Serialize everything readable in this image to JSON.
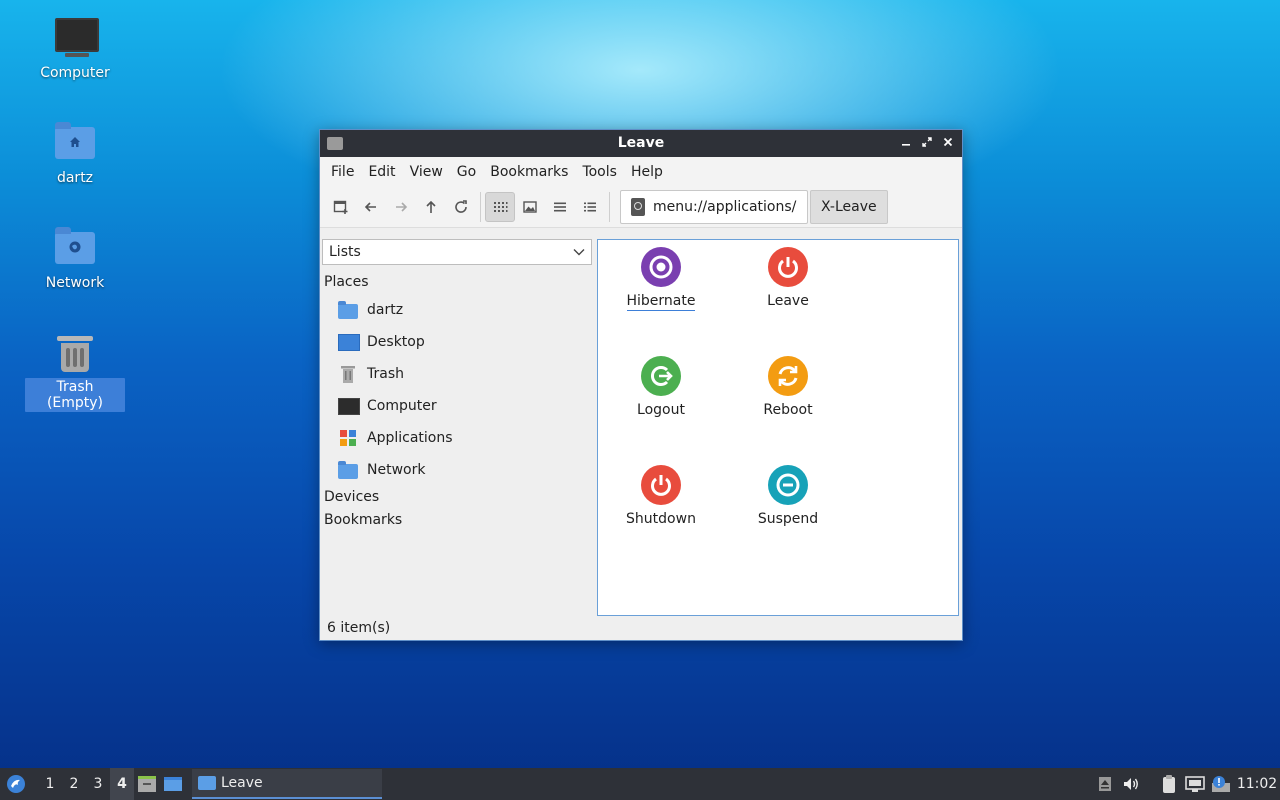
{
  "desktop": {
    "icons": [
      {
        "label": "Computer",
        "icon": "computer-icon"
      },
      {
        "label": "dartz",
        "icon": "home-folder-icon"
      },
      {
        "label": "Network",
        "icon": "network-folder-icon"
      },
      {
        "label": "Trash (Empty)",
        "icon": "trash-icon"
      }
    ]
  },
  "window": {
    "title": "Leave",
    "menu": [
      "File",
      "Edit",
      "View",
      "Go",
      "Bookmarks",
      "Tools",
      "Help"
    ],
    "path": "menu://applications/",
    "breadcrumb": "X-Leave",
    "sidebar": {
      "selector": "Lists",
      "sections": {
        "places": "Places",
        "devices": "Devices",
        "bookmarks": "Bookmarks"
      },
      "places": [
        {
          "label": "dartz",
          "icon": "home-folder-icon"
        },
        {
          "label": "Desktop",
          "icon": "desktop-icon"
        },
        {
          "label": "Trash",
          "icon": "trash-icon"
        },
        {
          "label": "Computer",
          "icon": "computer-icon"
        },
        {
          "label": "Applications",
          "icon": "applications-icon"
        },
        {
          "label": "Network",
          "icon": "network-folder-icon"
        }
      ]
    },
    "items": [
      {
        "label": "Hibernate",
        "icon": "hibernate-icon",
        "color": "#7a3fb0"
      },
      {
        "label": "Leave",
        "icon": "power-icon",
        "color": "#e84c3d"
      },
      {
        "label": "Logout",
        "icon": "logout-icon",
        "color": "#4caf50"
      },
      {
        "label": "Reboot",
        "icon": "reboot-icon",
        "color": "#f39c12"
      },
      {
        "label": "Shutdown",
        "icon": "shutdown-icon",
        "color": "#e84c3d"
      },
      {
        "label": "Suspend",
        "icon": "suspend-icon",
        "color": "#17a2b8"
      }
    ],
    "status": "6 item(s)"
  },
  "taskbar": {
    "workspaces": [
      "1",
      "2",
      "3",
      "4"
    ],
    "active_workspace": "4",
    "task": "Leave",
    "clock": "11:02"
  }
}
